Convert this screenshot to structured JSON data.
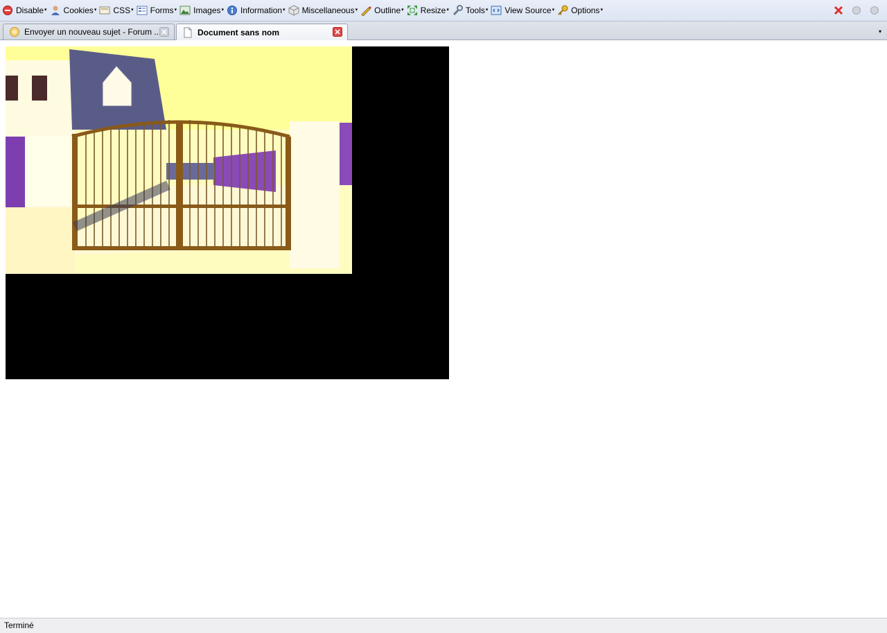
{
  "toolbar": {
    "items": [
      {
        "label": "Disable",
        "icon": "disable-icon"
      },
      {
        "label": "Cookies",
        "icon": "cookies-icon"
      },
      {
        "label": "CSS",
        "icon": "css-icon"
      },
      {
        "label": "Forms",
        "icon": "forms-icon"
      },
      {
        "label": "Images",
        "icon": "images-icon"
      },
      {
        "label": "Information",
        "icon": "information-icon"
      },
      {
        "label": "Miscellaneous",
        "icon": "miscellaneous-icon"
      },
      {
        "label": "Outline",
        "icon": "outline-icon"
      },
      {
        "label": "Resize",
        "icon": "resize-icon"
      },
      {
        "label": "Tools",
        "icon": "tools-icon"
      },
      {
        "label": "View Source",
        "icon": "view-source-icon"
      },
      {
        "label": "Options",
        "icon": "options-icon"
      }
    ],
    "dropdown_glyph": "▾"
  },
  "tabs": [
    {
      "label": "Envoyer un nouveau sujet - Forum ...",
      "active": false
    },
    {
      "label": "Document sans nom",
      "active": true
    }
  ],
  "tab_list_glyph": "▾",
  "status": {
    "text": "Terminé"
  },
  "colors": {
    "accent_close": "#e03030",
    "content_bg": "#000000",
    "toolbar_bg": "#e3e9f5"
  }
}
